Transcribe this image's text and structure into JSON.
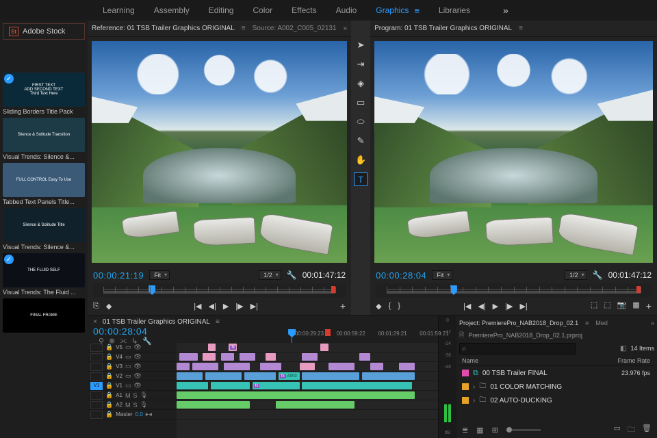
{
  "workspace": {
    "tabs": [
      "Learning",
      "Assembly",
      "Editing",
      "Color",
      "Effects",
      "Audio",
      "Graphics",
      "Libraries"
    ],
    "active": "Graphics"
  },
  "stock_label": "Adobe Stock",
  "templates": [
    {
      "title": "Sliding Borders Title Pack",
      "thumb_text": "FIRST TEXT\nADD SECOND TEXT\nThird Text Here",
      "checked": true,
      "bg": "#0a2a3a"
    },
    {
      "title": "Visual Trends: Silence &...",
      "thumb_text": "Silence & Solitude Transition",
      "bg": "#1d3a47"
    },
    {
      "title": "Tabbed Text Panels Title...",
      "thumb_text": "FULL CONTROL  Easy To Use",
      "bg": "#3a5a78"
    },
    {
      "title": "Visual Trends: Silence &...",
      "thumb_text": "Silence & Solitude Title",
      "bg": "#10212c"
    },
    {
      "title": "Visual Trends: The Fluid ...",
      "thumb_text": "THE FLUID SELF",
      "checked": true,
      "bg": "#0c1016"
    },
    {
      "title": "",
      "thumb_text": "FINAL FRAME",
      "bg": "#000"
    }
  ],
  "reference": {
    "tab_label": "Reference: 01 TSB Trailer Graphics ORIGINAL",
    "source_label": "Source: A002_C005_02131",
    "timecode_in": "00:00:21:19",
    "timecode_dur": "00:01:47:12",
    "fit": "Fit",
    "res": "1/2"
  },
  "program": {
    "tab_label": "Program: 01 TSB Trailer Graphics ORIGINAL",
    "timecode_in": "00:00:28:04",
    "timecode_dur": "00:01:47:12",
    "fit": "Fit",
    "res": "1/2"
  },
  "timeline": {
    "title": "01 TSB Trailer Graphics ORIGINAL",
    "playhead_tc": "00:00:28:04",
    "ruler_labels": [
      "00:00:29:23",
      "00:00:59:22",
      "00:01:29:21",
      "00:01:59:21"
    ],
    "video_tracks": [
      "V5",
      "V4",
      "V3",
      "V2",
      "V1"
    ],
    "audio_tracks": [
      "A1",
      "A2",
      "Master"
    ],
    "zoom": "0.0",
    "clip_label_a003": "A003"
  },
  "audio_meter": {
    "labels": [
      "0",
      "-12",
      "-24",
      "-36",
      "-48",
      "dB"
    ]
  },
  "project": {
    "tab": "Project: PremierePro_NAB2018_Drop_02.1",
    "tab2": "Med",
    "path": "PremierePro_NAB2018_Drop_02.1.prproj",
    "item_count": "14 Items",
    "col_name": "Name",
    "col_fps": "Frame Rate",
    "rows": [
      {
        "swatch": "pink",
        "type": "seq",
        "name": "00 TSB Trailer FINAL",
        "fps": "23.976 fps"
      },
      {
        "swatch": "orange",
        "type": "folder",
        "name": "01 COLOR MATCHING",
        "fps": ""
      },
      {
        "swatch": "orange",
        "type": "folder",
        "name": "02 AUTO-DUCKING",
        "fps": ""
      }
    ],
    "search_placeholder": ""
  }
}
